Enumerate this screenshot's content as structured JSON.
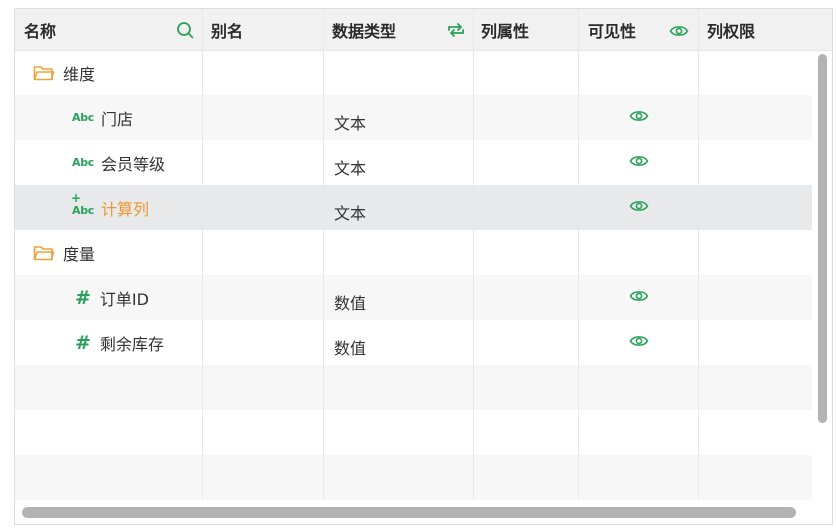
{
  "header": {
    "name": "名称",
    "alias": "别名",
    "data_type": "数据类型",
    "col_attr": "列属性",
    "visible": "可见性",
    "col_perm": "列权限",
    "icons": {
      "name": "search-icon",
      "data_type": "swap-icon",
      "visible": "eye-icon"
    }
  },
  "rows": [
    {
      "kind": "folder",
      "name": "维度",
      "type": "",
      "visible": false
    },
    {
      "kind": "text",
      "icon": "Abc",
      "name": "门店",
      "type": "文本",
      "visible": true
    },
    {
      "kind": "text",
      "icon": "Abc",
      "name": "会员等级",
      "type": "文本",
      "visible": true
    },
    {
      "kind": "calc",
      "icon": "Abc",
      "name": "计算列",
      "type": "文本",
      "visible": true,
      "selected": true
    },
    {
      "kind": "folder",
      "name": "度量",
      "type": "",
      "visible": false
    },
    {
      "kind": "number",
      "icon": "#",
      "name": "订单ID",
      "type": "数值",
      "visible": true
    },
    {
      "kind": "number",
      "icon": "#",
      "name": "剩余库存",
      "type": "数值",
      "visible": true
    }
  ],
  "colors": {
    "accent": "#2aa15a",
    "folder": "#f0a23a",
    "selected_text": "#f0962d"
  }
}
